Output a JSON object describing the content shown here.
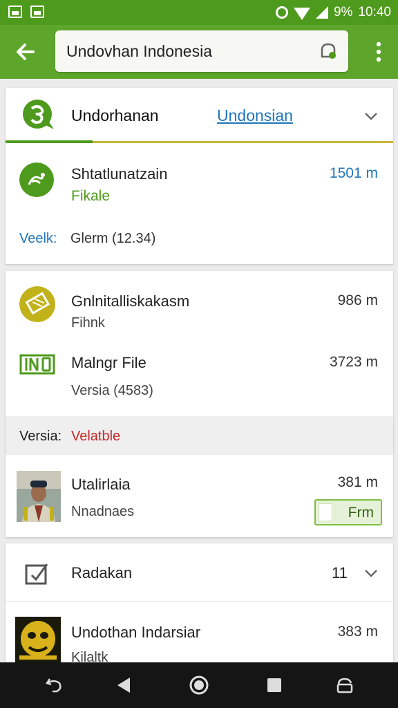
{
  "status_bar": {
    "battery": "9%",
    "time": "10:40",
    "icons": [
      "screenshot-icon",
      "image-icon",
      "alarm-icon",
      "wifi-icon",
      "signal-icon"
    ]
  },
  "app_bar": {
    "search_value": "Undovhan Indonesia",
    "back_icon": "arrow-left-icon",
    "search_icon": "search-icon",
    "menu_icon": "more-vertical-icon"
  },
  "header_card": {
    "title": "Undorhanan",
    "link": "Undonsian",
    "item": {
      "title": "Shtatlunatzain",
      "subtitle": "Fikale",
      "distance": "1501 m"
    },
    "detail_label": "Veelk:",
    "detail_value": "Glerm (12.34)"
  },
  "list_card": {
    "items": [
      {
        "title": "Gnlnitalliskakasm",
        "subtitle": "Fihnk",
        "distance": "986 m"
      },
      {
        "title": "Malngr File",
        "subtitle": "Versia (4583)",
        "distance": "3723 m"
      },
      {
        "title": "Utalirlaia",
        "subtitle": "Nnadnaes",
        "distance": "381 m",
        "button": "Frm"
      }
    ],
    "version_label": "Versia:",
    "version_value": "Velatble"
  },
  "bottom_card": {
    "header_title": "Radakan",
    "header_count": "11",
    "item": {
      "title": "Undothan Indarsiar",
      "subtitle": "Kilaltk",
      "distance": "383 m"
    }
  },
  "colors": {
    "primary": "#5ea62b",
    "status_bar": "#4e9a1c",
    "link": "#1f76b9",
    "accent_yellow": "#c9b63a",
    "warning_red": "#c62828"
  }
}
